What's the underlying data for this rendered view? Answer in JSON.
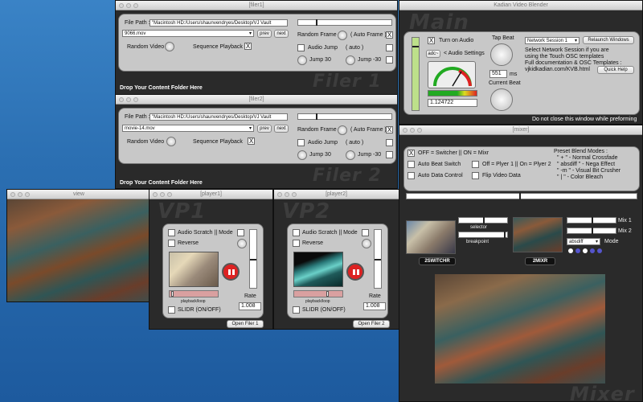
{
  "filer1": {
    "title": "[filer1]",
    "file_path_label": "File Path :",
    "file_path": "\"Macintosh HD:/Users/shaunvendryes/Desktop/VJ Vault",
    "movie": "9066.mov",
    "prev": "prev",
    "next": "next",
    "random_video": "Random Video",
    "sequence_playback": "Sequence Playback",
    "sequence_checked": "X",
    "random_frame": "Random Frame",
    "auto_frame": "( Auto Frame )",
    "auto_frame_checked": "X",
    "audio_jump": "Audio Jump",
    "auto": "( auto )",
    "jump30": "Jump 30",
    "jump_minus30": "Jump -30",
    "watermark": "Filer 1",
    "drop_label": "Drop Your Content Folder Here"
  },
  "filer2": {
    "title": "[filer2]",
    "file_path_label": "File Path :",
    "file_path": "\"Macintosh HD:/Users/shaunvendryes/Desktop/VJ Vault",
    "movie": "movie-14.mov",
    "prev": "prev",
    "next": "next",
    "random_video": "Random Video",
    "sequence_playback": "Sequence Playback",
    "sequence_checked": "X",
    "random_frame": "Random Frame",
    "auto_frame": "( Auto Frame )",
    "auto_frame_checked": "X",
    "audio_jump": "Audio Jump",
    "auto": "( auto )",
    "jump30": "Jump 30",
    "jump_minus30": "Jump -30",
    "watermark": "Filer 2",
    "drop_label": "Drop Your Content Folder Here"
  },
  "main": {
    "title": "Kadian Video Blender",
    "watermark": "Main",
    "turn_on_audio": "Turn on Audio",
    "turn_on_audio_checked": "X",
    "adc": "adc~",
    "audio_settings": "< Audio Settings",
    "level_value": "1.124722",
    "tap_beat": "Tap Beat",
    "ms_value": "551",
    "ms_label": "ms",
    "current_beat": "Current Beat",
    "network_session": "Network Session 1",
    "relaunch": "Relaunch Windows",
    "info_lines": [
      "Select Network Session if you are",
      "using the Touch OSC templates",
      "Full documentation & OSC Templates :",
      "vjkidkadian.com/KVB.html"
    ],
    "quick_help": "Quick Help",
    "warning": "Do not close this window while preforming"
  },
  "view": {
    "title": "view"
  },
  "player1": {
    "title": "[player1]",
    "watermark": "VP1",
    "audio_scratch": "Audio Scratch || Mode",
    "reverse": "Reverse",
    "playback_loop": "playback/loop",
    "slidr": "SLIDR (ON/OFF)",
    "rate_label": "Rate",
    "rate_value": "1.008",
    "open_filer": "Open Filer 1"
  },
  "player2": {
    "title": "[player2]",
    "watermark": "VP2",
    "audio_scratch": "Audio Scratch || Mode",
    "reverse": "Reverse",
    "playback_loop": "playback/loop",
    "slidr": "SLIDR (ON/OFF)",
    "rate_label": "Rate",
    "rate_value": "1.008",
    "open_filer": "Open Filer 2"
  },
  "mixer": {
    "title": "[mixer]",
    "off_switcher": "OFF = Switcher || ON = Mixr",
    "off_switcher_checked": "X",
    "auto_beat_switch": "Auto Beat Switch",
    "auto_data_control": "Auto Data Control",
    "player_toggle": "Off = Plyer 1 || On = Plyer 2",
    "flip_video": "Flip Video Data",
    "preset_title": "Preset Blend Modes :",
    "preset_lines": [
      "\" + \" - Normal Crossfade",
      "\" absdiff \" - Nega Effect",
      "\" -m \" - Visual Bit Crusher",
      "\" | \" - Color Bleach"
    ],
    "selector": "selector",
    "breakpoint": "breakpoint",
    "switchr_label": "2SWITCHR",
    "mixr_label": "2MIXR",
    "mix1": "Mix 1",
    "mix2": "Mix 2",
    "mode_value": "absdiff",
    "mode_label": "Mode",
    "watermark": "Mixer"
  }
}
